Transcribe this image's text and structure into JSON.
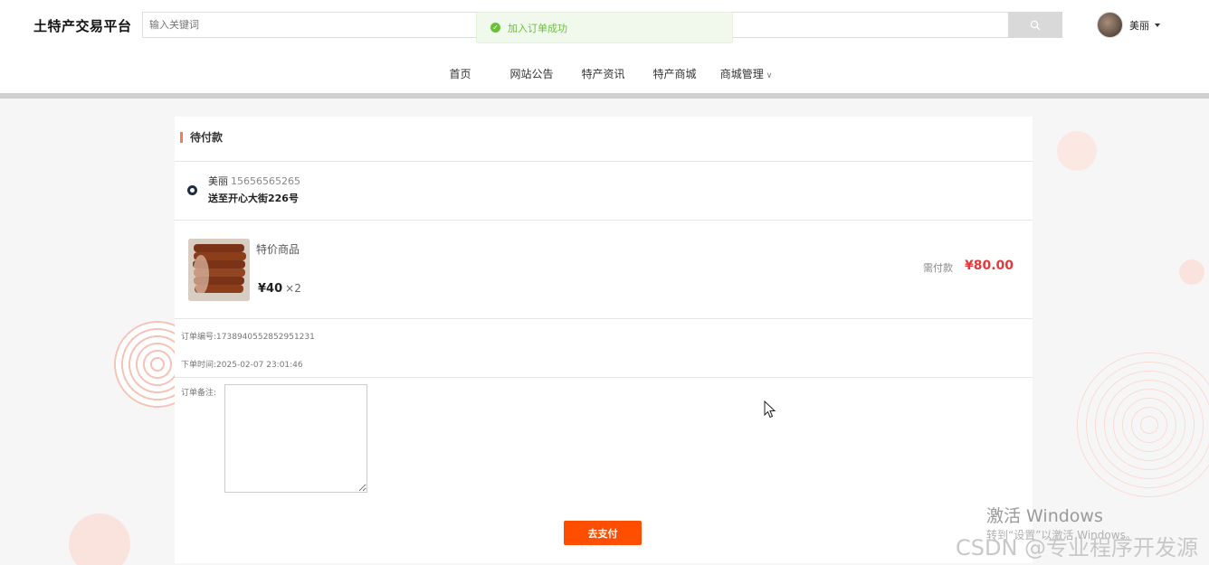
{
  "header": {
    "brand": "土特产交易平台",
    "search_placeholder": "输入关键词",
    "user_name": "美丽"
  },
  "toast": {
    "message": "加入订单成功"
  },
  "nav": {
    "items": [
      {
        "label": "首页",
        "color": "#0ea195"
      },
      {
        "label": "网站公告",
        "color": "#f07c62"
      },
      {
        "label": "特产资讯",
        "color": "#fccd6d"
      },
      {
        "label": "特产商城",
        "color": "#2b8cd9"
      },
      {
        "label": "商城管理",
        "color": "#0ea195"
      }
    ]
  },
  "order": {
    "status_title": "待付款",
    "address": {
      "name": "美丽",
      "phone": "15656565265",
      "detail": "送至开心大街226号"
    },
    "product": {
      "name": "特价商品",
      "price": "¥40",
      "qty": "×2"
    },
    "pay_label": "需付款",
    "pay_amount": "¥80.00",
    "order_no_label": "订单编号:",
    "order_no": "1738940552852951231",
    "order_time_label": "下单时间:",
    "order_time": "2025-02-07 23:01:46",
    "remark_label": "订单备注:",
    "pay_button": "去支付"
  },
  "watermark": {
    "activate_title": "激活 Windows",
    "activate_sub": "转到“设置”以激活 Windows。",
    "csdn": "CSDN @专业程序开发源"
  }
}
